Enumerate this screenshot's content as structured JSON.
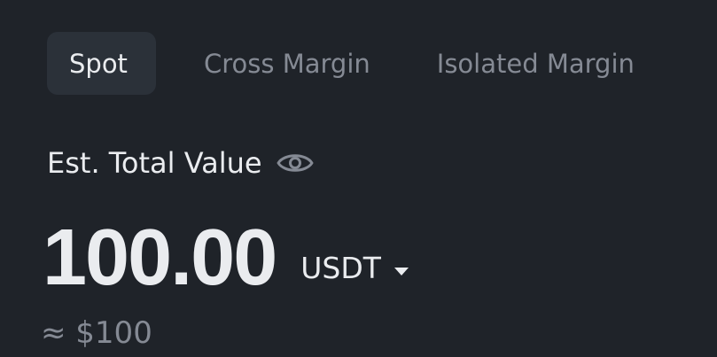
{
  "tabs": [
    {
      "label": "Spot",
      "active": true
    },
    {
      "label": "Cross Margin",
      "active": false
    },
    {
      "label": "Isolated Margin",
      "active": false
    }
  ],
  "balance": {
    "label": "Est. Total Value",
    "visibility_icon": "eye-icon",
    "value": "100.00",
    "currency": "USDT",
    "currency_dropdown_icon": "caret-down-icon",
    "fiat_approx": "≈ $100"
  },
  "colors": {
    "background": "#1f2329",
    "active_tab_bg": "#2b3139",
    "primary_text": "#eaecef",
    "secondary_text": "#858a94"
  }
}
